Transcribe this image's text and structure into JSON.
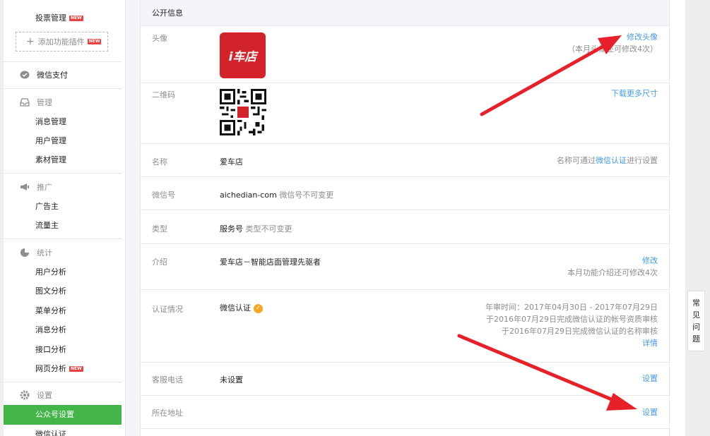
{
  "sidebar": {
    "top_item": "投票管理",
    "new_badge": "NEW",
    "add_plugin": "添加功能插件",
    "wechat_pay": "微信支付",
    "manage": {
      "head": "管理",
      "items": [
        "消息管理",
        "用户管理",
        "素材管理"
      ]
    },
    "promote": {
      "head": "推广",
      "items": [
        "广告主",
        "流量主"
      ]
    },
    "stats": {
      "head": "统计",
      "items": [
        "用户分析",
        "图文分析",
        "菜单分析",
        "消息分析",
        "接口分析",
        "网页分析"
      ]
    },
    "settings": {
      "head": "设置",
      "active": "公众号设置",
      "next": "微信认证"
    }
  },
  "panel": {
    "title": "公开信息",
    "avatar": {
      "label": "头像",
      "logo_text": "i车店",
      "action": "修改头像",
      "note": "（本月头像还可修改4次）"
    },
    "qrcode": {
      "label": "二维码",
      "action": "下载更多尺寸"
    },
    "name": {
      "label": "名称",
      "value": "爱车店",
      "note_prefix": "名称可通过",
      "note_link": "微信认证",
      "note_suffix": "进行设置"
    },
    "wechat_id": {
      "label": "微信号",
      "value": "aichedian-com",
      "hint": "微信号不可变更"
    },
    "type": {
      "label": "类型",
      "value": "服务号",
      "hint": "类型不可变更"
    },
    "intro": {
      "label": "介绍",
      "value": "爱车店－智能店面管理先驱者",
      "action": "修改",
      "note": "本月功能介绍还可修改4次"
    },
    "verification": {
      "label": "认证情况",
      "value": "微信认证",
      "line1": "年审时间：2017年04月30日 - 2017年07月29日",
      "line2": "于2016年07月29日完成微信认证的帐号资质审核",
      "line3": "于2016年07月29日完成微信认证的名称审核",
      "action": "详情"
    },
    "phone": {
      "label": "客服电话",
      "value": "未设置",
      "action": "设置"
    },
    "address": {
      "label": "所在地址",
      "action": "设置"
    }
  },
  "faq": {
    "chars": [
      "常",
      "见",
      "问",
      "题"
    ]
  },
  "colors": {
    "accent_green": "#44b549",
    "link_blue": "#459ae9",
    "arrow_red": "#e8202a",
    "logo_red": "#d2232a"
  }
}
